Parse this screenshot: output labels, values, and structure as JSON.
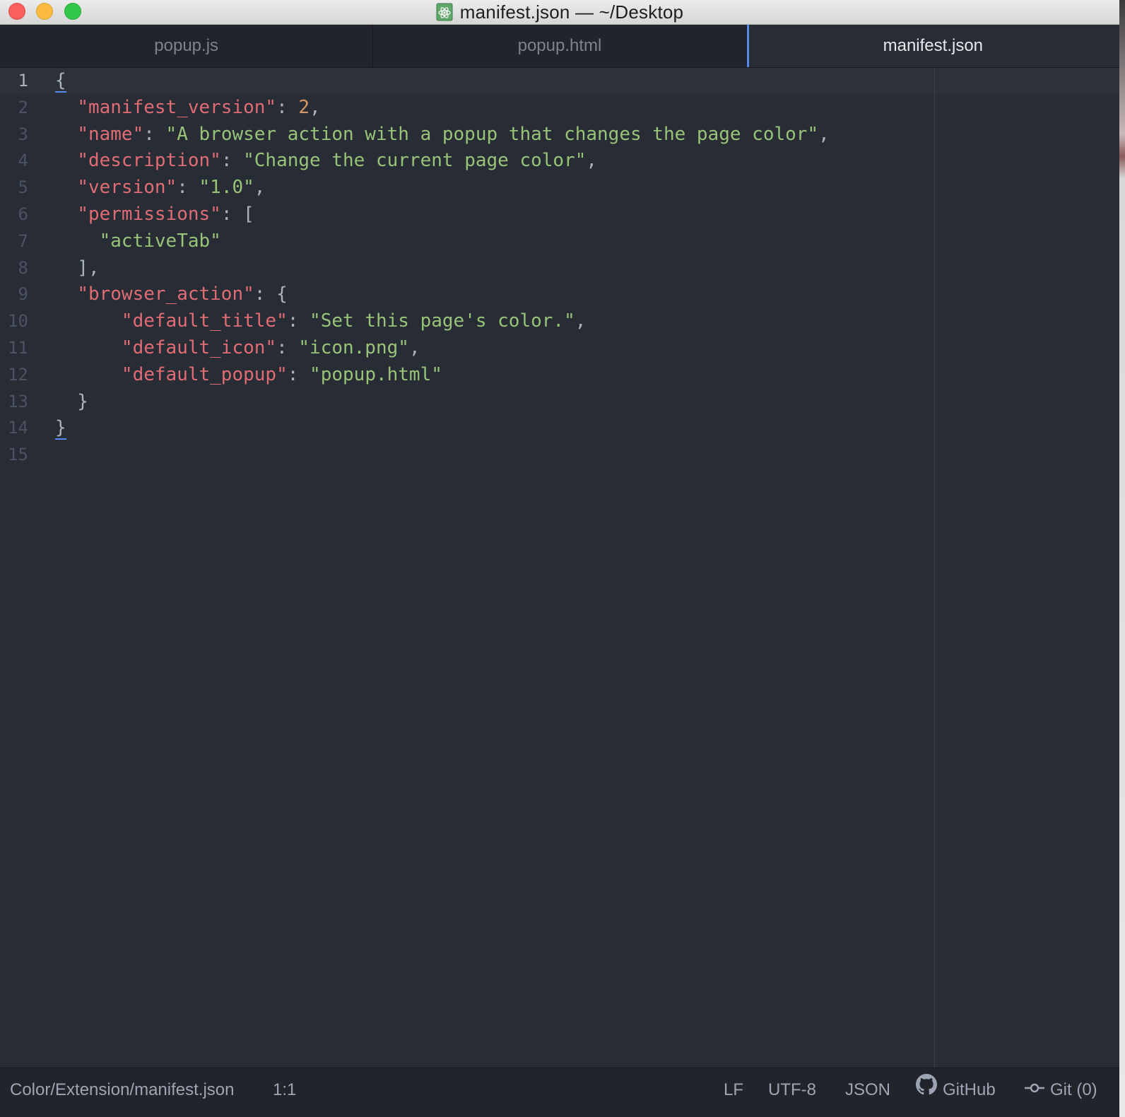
{
  "window": {
    "title": "manifest.json — ~/Desktop"
  },
  "tabs": [
    {
      "label": "popup.js",
      "active": false
    },
    {
      "label": "popup.html",
      "active": false
    },
    {
      "label": "manifest.json",
      "active": true
    }
  ],
  "editor": {
    "line_numbers": [
      "1",
      "2",
      "3",
      "4",
      "5",
      "6",
      "7",
      "8",
      "9",
      "10",
      "11",
      "12",
      "13",
      "14",
      "15"
    ],
    "lines": [
      [
        {
          "t": "p",
          "v": "{",
          "bm": true
        }
      ],
      [
        {
          "t": "p",
          "v": "  "
        },
        {
          "t": "k",
          "v": "\"manifest_version\""
        },
        {
          "t": "p",
          "v": ": "
        },
        {
          "t": "n",
          "v": "2"
        },
        {
          "t": "p",
          "v": ","
        }
      ],
      [
        {
          "t": "p",
          "v": "  "
        },
        {
          "t": "k",
          "v": "\"name\""
        },
        {
          "t": "p",
          "v": ": "
        },
        {
          "t": "s",
          "v": "\"A browser action with a popup that changes the page color\""
        },
        {
          "t": "p",
          "v": ","
        }
      ],
      [
        {
          "t": "p",
          "v": "  "
        },
        {
          "t": "k",
          "v": "\"description\""
        },
        {
          "t": "p",
          "v": ": "
        },
        {
          "t": "s",
          "v": "\"Change the current page color\""
        },
        {
          "t": "p",
          "v": ","
        }
      ],
      [
        {
          "t": "p",
          "v": "  "
        },
        {
          "t": "k",
          "v": "\"version\""
        },
        {
          "t": "p",
          "v": ": "
        },
        {
          "t": "s",
          "v": "\"1.0\""
        },
        {
          "t": "p",
          "v": ","
        }
      ],
      [
        {
          "t": "p",
          "v": "  "
        },
        {
          "t": "k",
          "v": "\"permissions\""
        },
        {
          "t": "p",
          "v": ": ["
        }
      ],
      [
        {
          "t": "p",
          "v": "    "
        },
        {
          "t": "s",
          "v": "\"activeTab\""
        }
      ],
      [
        {
          "t": "p",
          "v": "  ],"
        }
      ],
      [
        {
          "t": "p",
          "v": "  "
        },
        {
          "t": "k",
          "v": "\"browser_action\""
        },
        {
          "t": "p",
          "v": ": {"
        }
      ],
      [
        {
          "t": "p",
          "v": "      "
        },
        {
          "t": "k",
          "v": "\"default_title\""
        },
        {
          "t": "p",
          "v": ": "
        },
        {
          "t": "s",
          "v": "\"Set this page's color.\""
        },
        {
          "t": "p",
          "v": ","
        }
      ],
      [
        {
          "t": "p",
          "v": "      "
        },
        {
          "t": "k",
          "v": "\"default_icon\""
        },
        {
          "t": "p",
          "v": ": "
        },
        {
          "t": "s",
          "v": "\"icon.png\""
        },
        {
          "t": "p",
          "v": ","
        }
      ],
      [
        {
          "t": "p",
          "v": "      "
        },
        {
          "t": "k",
          "v": "\"default_popup\""
        },
        {
          "t": "p",
          "v": ": "
        },
        {
          "t": "s",
          "v": "\"popup.html\""
        }
      ],
      [
        {
          "t": "p",
          "v": "  }"
        }
      ],
      [
        {
          "t": "p",
          "v": "}",
          "bm": true
        }
      ],
      []
    ]
  },
  "statusbar": {
    "file_path": "Color/Extension/manifest.json",
    "cursor_position": "1:1",
    "line_ending": "LF",
    "encoding": "UTF-8",
    "grammar": "JSON",
    "github_label": "GitHub",
    "git_label": "Git (0)"
  },
  "colors": {
    "key": "#e06c75",
    "string": "#98c379",
    "number": "#d19a66",
    "punctuation": "#abb2bf",
    "accent": "#568af2",
    "editor_bg": "#282c34"
  },
  "icons": {
    "title_icon": "atom-icon",
    "github_icon": "github-octocat-icon",
    "git_icon": "git-commit-icon"
  }
}
